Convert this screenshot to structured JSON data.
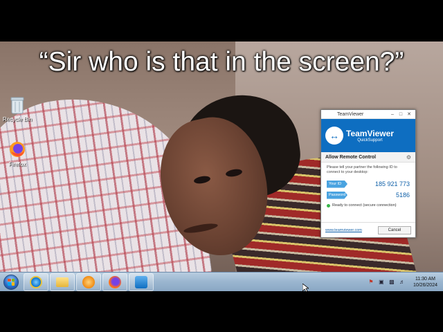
{
  "caption": "“Sir who is that in the screen?”",
  "desktop": {
    "icons": [
      {
        "label": "Recycle Bin",
        "icon": "recycle-bin-icon"
      },
      {
        "label": "Firefox",
        "icon": "firefox-icon"
      }
    ]
  },
  "teamviewer": {
    "window_title": "TeamViewer",
    "brand": "TeamViewer",
    "product": "QuickSupport",
    "section_title": "Allow Remote Control",
    "description": "Please tell your partner the following ID to connect to your desktop:",
    "id_label": "Your ID",
    "id_value": "185 921 773",
    "password_label": "Password",
    "password_value": "5186",
    "status": "Ready to connect (secure connection)",
    "link": "www.teamviewer.com",
    "cancel_label": "Cancel",
    "colors": {
      "header": "#0e6ec1",
      "tag": "#4aa3e0",
      "status": "#39b54a"
    }
  },
  "taskbar": {
    "pinned": [
      {
        "name": "internet-explorer",
        "icon": "internet-explorer-icon"
      },
      {
        "name": "file-explorer",
        "icon": "folder-icon"
      },
      {
        "name": "media-player",
        "icon": "media-player-icon"
      },
      {
        "name": "firefox",
        "icon": "firefox-icon"
      },
      {
        "name": "teamviewer",
        "icon": "teamviewer-icon"
      }
    ],
    "tray_icons": [
      "flag-icon",
      "network-icon",
      "display-icon",
      "volume-icon"
    ],
    "time": "11:30 AM",
    "date": "10/26/2024"
  }
}
